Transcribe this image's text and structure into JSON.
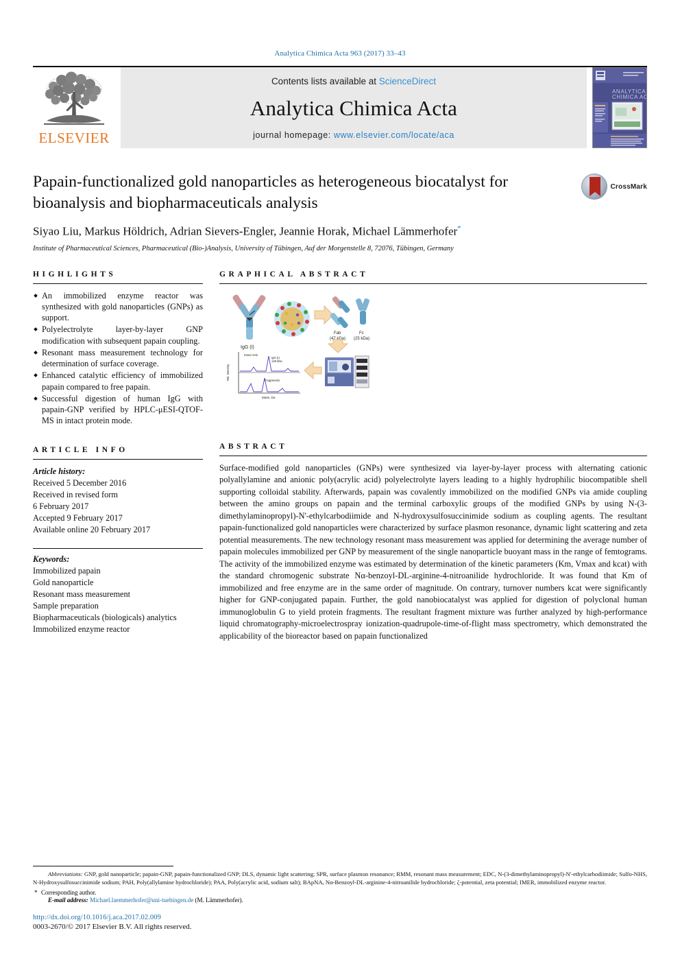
{
  "journal_ref": "Analytica Chimica Acta 963 (2017) 33–43",
  "masthead": {
    "publisher": "ELSEVIER",
    "contents_prefix": "Contents lists available at ",
    "contents_link": "ScienceDirect",
    "journal_name": "Analytica Chimica Acta",
    "homepage_prefix": "journal homepage: ",
    "homepage_url": "www.elsevier.com/locate/aca",
    "cover_title_line1": "ANALYTICA",
    "cover_title_line2": "CHIMICA ACTA"
  },
  "article": {
    "title": "Papain-functionalized gold nanoparticles as heterogeneous biocatalyst for bioanalysis and biopharmaceuticals analysis",
    "authors": "Siyao Liu, Markus Höldrich, Adrian Sievers-Engler, Jeannie Horak, Michael Lämmerhofer",
    "author_marker": "*",
    "affiliation": "Institute of Pharmaceutical Sciences, Pharmaceutical (Bio-)Analysis, University of Tübingen, Auf der Morgenstelle 8, 72076, Tübingen, Germany",
    "crossmark_label": "CrossMark"
  },
  "sections": {
    "highlights_heading": "HIGHLIGHTS",
    "graphical_abstract_heading": "GRAPHICAL ABSTRACT",
    "article_info_heading": "ARTICLE INFO",
    "abstract_heading": "ABSTRACT"
  },
  "highlights": [
    "An immobilized enzyme reactor was synthesized with gold nanoparticles (GNPs) as support.",
    "Polyelectrolyte layer-by-layer GNP modification with subsequent papain coupling.",
    "Resonant mass measurement technology for determination of surface coverage.",
    "Enhanced catalytic efficiency of immobilized papain compared to free papain.",
    "Successful digestion of human IgG with papain-GNP verified by HPLC-μESI-QTOF-MS in intact protein mode."
  ],
  "article_info": {
    "history_label": "Article history:",
    "history": [
      "Received 5 December 2016",
      "Received in revised form",
      "6 February 2017",
      "Accepted 9 February 2017",
      "Available online 20 February 2017"
    ],
    "keywords_label": "Keywords:",
    "keywords": [
      "Immobilized papain",
      "Gold nanoparticle",
      "Resonant mass measurement",
      "Sample preparation",
      "Biopharmaceuticals (biologicals) analytics",
      "Immobilized enzyme reactor"
    ]
  },
  "abstract": "Surface-modified gold nanoparticles (GNPs) were synthesized via layer-by-layer process with alternating cationic polyallylamine and anionic poly(acrylic acid) polyelectrolyte layers leading to a highly hydrophilic biocompatible shell supporting colloidal stability. Afterwards, papain was covalently immobilized on the modified GNPs via amide coupling between the amino groups on papain and the terminal carboxylic groups of the modified GNPs by using N-(3-dimethylaminopropyl)-N'-ethylcarbodiimide and N-hydroxysulfosuccinimide sodium as coupling agents. The resultant papain-functionalized gold nanoparticles were characterized by surface plasmon resonance, dynamic light scattering and zeta potential measurements. The new technology resonant mass measurement was applied for determining the average number of papain molecules immobilized per GNP by measurement of the single nanoparticle buoyant mass in the range of femtograms. The activity of the immobilized enzyme was estimated by determination of the kinetic parameters (Km, Vmax and kcat) with the standard chromogenic substrate Nα-benzoyl-DL-arginine-4-nitroanilide hydrochloride. It was found that Km of immobilized and free enzyme are in the same order of magnitude. On contrary, turnover numbers kcat were significantly higher for GNP-conjugated papain. Further, the gold nanobiocatalyst was applied for digestion of polyclonal human immunoglobulin G to yield protein fragments. The resultant fragment mixture was further analyzed by high-performance liquid chromatography-microelectrospray ionization-quadrupole-time-of-flight mass spectrometry, which demonstrated the applicability of the bioreactor based on papain functionalized",
  "graphical_abstract_labels": {
    "igg": "IgG (I)",
    "fab": "Fab",
    "fab_sub": "(47 kDa)",
    "fc": "Fc",
    "fc_sub": "(25 kDa)",
    "plot_top": "Intact mAb",
    "plot_peak": "IgG (I)",
    "plot_peak_sub": "148 kDa",
    "plot_bottom": "Fragments",
    "y_axis": "Rel. Intensity",
    "x_axis": "Mass, Da"
  },
  "footnotes": {
    "abbrev_label": "Abbreviations:",
    "abbreviations": "GNP, gold nanoparticle; papain-GNP, papain-functionalized GNP; DLS, dynamic light scattering; SPR, surface plasmon resonance; RMM, resonant mass measurement; EDC, N-(3-dimethylaminopropyl)-N'-ethylcarbodiimide; Sulfo-NHS, N-Hydroxysulfosuccinimide sodium; PAH, Poly(allylamine hydrochloride); PAA, Poly(acrylic acid, sodium salt); BApNA, Nα-Benzoyl-DL-arginine-4-nitroanilide hydrochloride; ζ-potential, zeta potential; IMER, immobilized enzyme reactor.",
    "corresponding": "Corresponding author.",
    "email_label": "E-mail address:",
    "email": "Michael.laemmerhofer@uni-tuebingen.de",
    "email_suffix": "(M. Lämmerhofer)."
  },
  "footer": {
    "doi": "http://dx.doi.org/10.1016/j.aca.2017.02.009",
    "copyright": "0003-2670/© 2017 Elsevier B.V. All rights reserved."
  },
  "colors": {
    "link_blue": "#1a6fa8",
    "elsevier_orange": "#E87722",
    "sciencedirect_blue": "#3a8fd0"
  }
}
